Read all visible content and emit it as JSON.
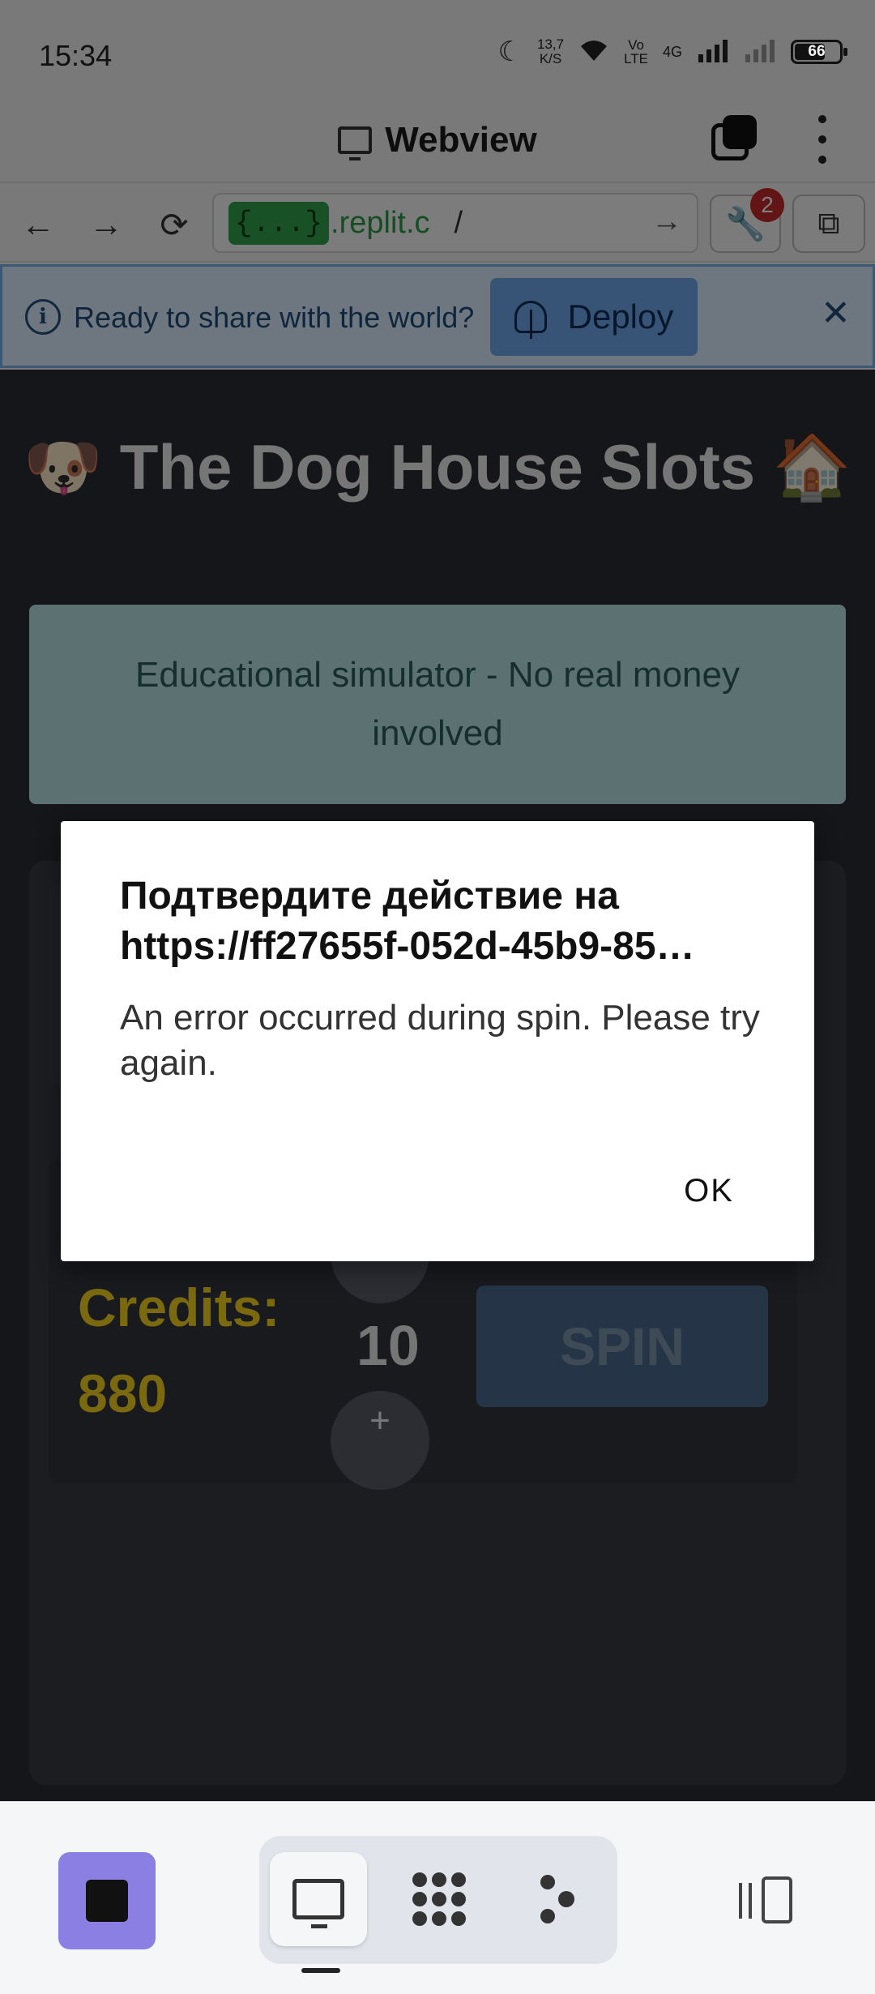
{
  "status": {
    "time": "15:34",
    "rate_top": "13,7",
    "rate_bottom": "K/S",
    "volte_top": "Vo",
    "volte_bottom": "LTE",
    "net": "4G",
    "battery": "66"
  },
  "header": {
    "title": "Webview"
  },
  "browser": {
    "url_pill": "{...}",
    "url_host": ".replit.c",
    "url_path": "/",
    "tools_badge": "2"
  },
  "banner": {
    "text": "Ready to share with the world?",
    "deploy_label": "Deploy"
  },
  "page": {
    "title": "🐶 The Dog House Slots 🏠",
    "notice": "Educational simulator - No real money involved",
    "reels": [
      "🦴",
      "🦴",
      "🐶",
      "🦴",
      "🐶"
    ],
    "credits_label": "Credits:",
    "credits_value": "880",
    "minus": "-",
    "plus": "+",
    "bet": "10",
    "spin": "SPIN"
  },
  "dialog": {
    "title_line1": "Подтвердите действие на",
    "title_line2": "https://ff27655f-052d-45b9-85…",
    "message": "An error occurred during spin. Please try again.",
    "ok": "OK"
  },
  "colors": {
    "accent_purple": "#8b7fe3",
    "credits_yellow": "#f7d321",
    "banner_blue": "#dceefe",
    "notice_teal": "#b8e3e3"
  }
}
